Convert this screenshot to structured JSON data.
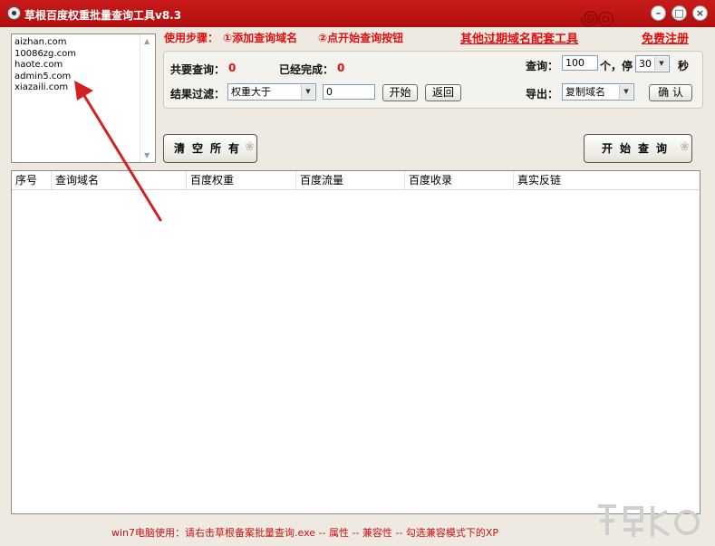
{
  "window": {
    "title": "草根百度权重批量查询工具v8.3",
    "minimize_glyph": "–",
    "maximize_glyph": "□",
    "close_glyph": "×"
  },
  "domain_list": [
    "aizhan.com",
    "10086zg.com",
    "haote.com",
    "admin5.com",
    "xiazaili.com"
  ],
  "steps": {
    "label": "使用步骤：",
    "step1": "①添加查询域名",
    "step2": "②点开始查询按钮",
    "other_tools_link": "其他过期域名配套工具",
    "free_register_link": "免费注册"
  },
  "stats": {
    "total_label": "共要查询：",
    "total_value": "0",
    "done_label": "已经完成：",
    "done_value": "0"
  },
  "query": {
    "label": "查询：",
    "count_value": "100",
    "count_unit": "个，停",
    "pause_value": "30",
    "pause_unit": "秒"
  },
  "filter": {
    "label": "结果过滤：",
    "select_value": "权重大于",
    "input_value": "0",
    "start_button": "开始",
    "back_button": "返回"
  },
  "export": {
    "label": "导出：",
    "select_value": "复制域名",
    "confirm_button": "确 认"
  },
  "actions": {
    "clear_button": "清空所有",
    "start_query_button": "开始查询"
  },
  "table": {
    "columns": [
      "序号",
      "查询域名",
      "百度权重",
      "百度流量",
      "百度收录",
      "真实反链"
    ],
    "rows": []
  },
  "footer": "win7电脑使用：请右击草根备案批量查询.exe -- 属性 -- 兼容性 -- 勾选兼容模式下的XP",
  "colors": {
    "titlebar": "#b91414",
    "accent_red": "#dd1111",
    "annotation_arrow": "#d42020",
    "background": "#eeeae2"
  }
}
